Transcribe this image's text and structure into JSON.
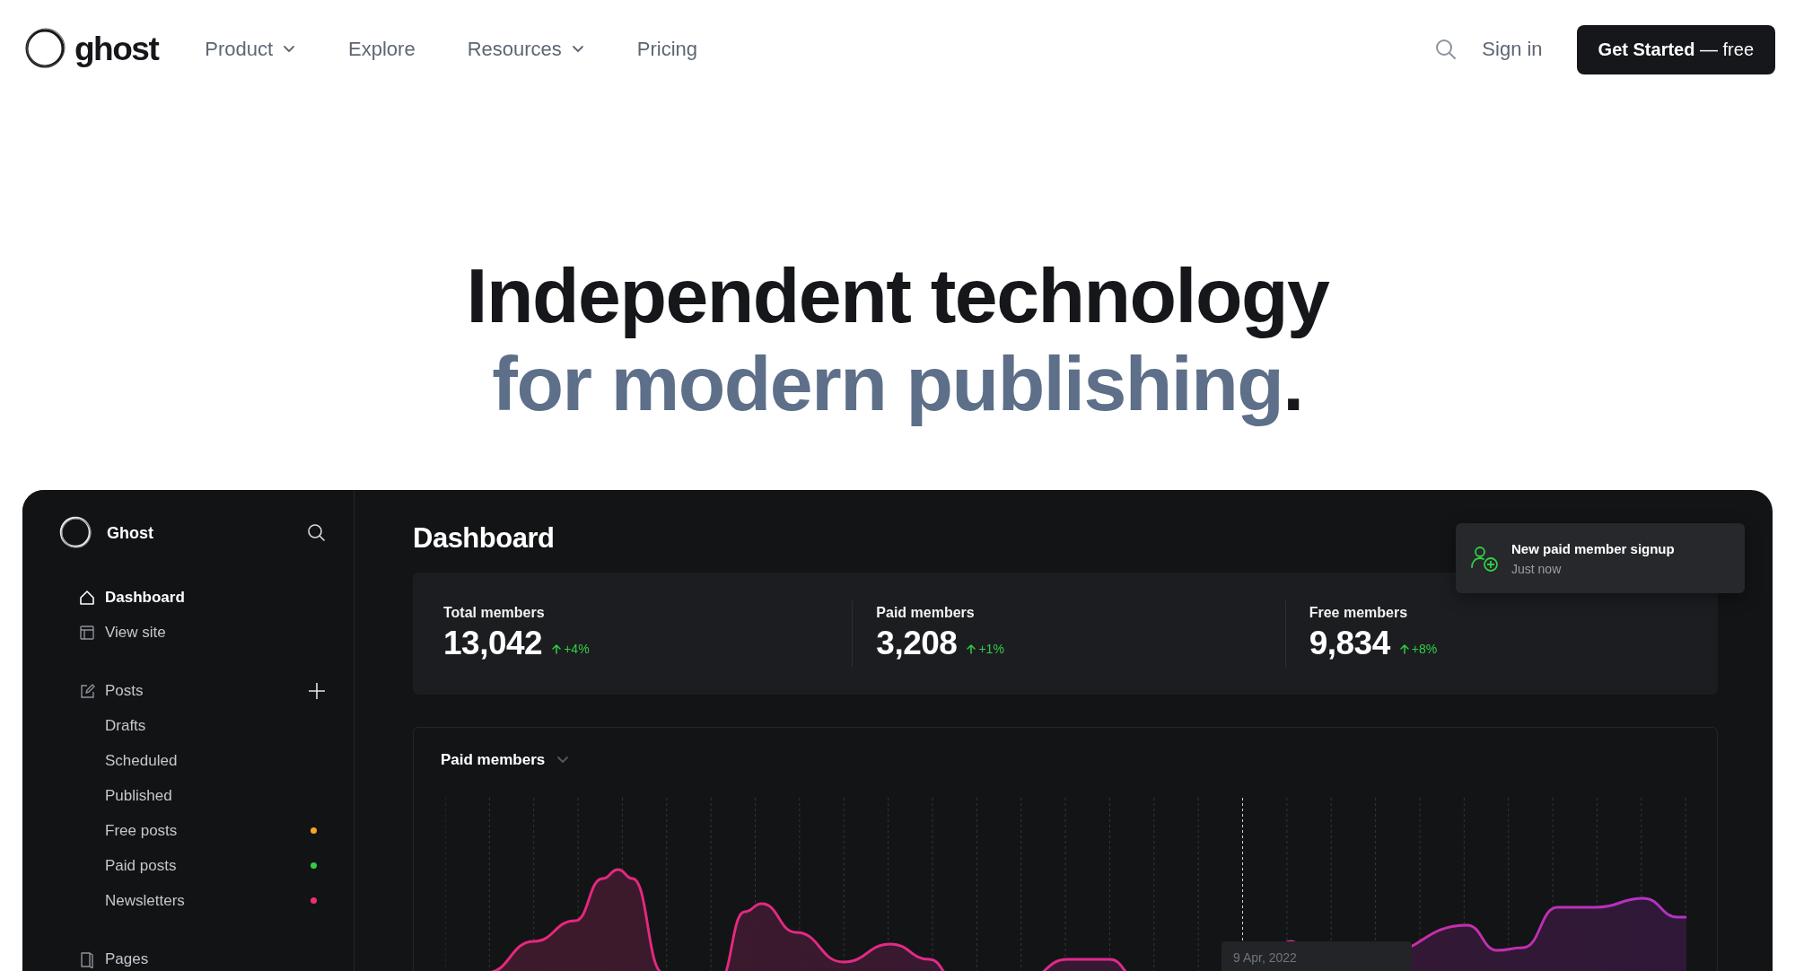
{
  "header": {
    "logo_text": "ghost",
    "nav": [
      {
        "label": "Product",
        "dropdown": true
      },
      {
        "label": "Explore",
        "dropdown": false
      },
      {
        "label": "Resources",
        "dropdown": true
      },
      {
        "label": "Pricing",
        "dropdown": false
      }
    ],
    "sign_in": "Sign in",
    "cta": "**Get Started** — free"
  },
  "hero": {
    "line1": "Independent technology",
    "line2": "for modern publishing",
    "period": "."
  },
  "dashboard": {
    "sidebar": {
      "site_name": "Ghost",
      "groups": [
        {
          "items": [
            {
              "label": "Dashboard",
              "selected": true
            },
            {
              "label": "View site",
              "selected": false
            }
          ]
        },
        {
          "items": [
            {
              "label": "Posts",
              "selected": false,
              "add": true,
              "children": [
                {
                  "label": "Drafts",
                  "selected": false
                },
                {
                  "label": "Scheduled",
                  "selected": false
                },
                {
                  "label": "Published",
                  "selected": false
                },
                {
                  "label": "Free posts",
                  "selected": false,
                  "color": "#f5a623"
                },
                {
                  "label": "Paid posts",
                  "selected": false,
                  "color": "#30cf43"
                },
                {
                  "label": "Newsletters",
                  "selected": false,
                  "color": "#f0306e"
                }
              ]
            }
          ]
        },
        {
          "items": [
            {
              "label": "Pages",
              "selected": false
            }
          ]
        }
      ]
    },
    "title": "Dashboard",
    "stats": [
      {
        "label": "Total members",
        "value": "13,042",
        "change": "+4%"
      },
      {
        "label": "Paid members",
        "value": "3,208",
        "change": "+1%"
      },
      {
        "label": "Free members",
        "value": "9,834",
        "change": "+8%"
      }
    ],
    "chart": {
      "title": "Paid members",
      "tooltip": "9 Apr, 2022"
    },
    "toast": {
      "title": "New paid member signup",
      "time": "Just now"
    }
  }
}
